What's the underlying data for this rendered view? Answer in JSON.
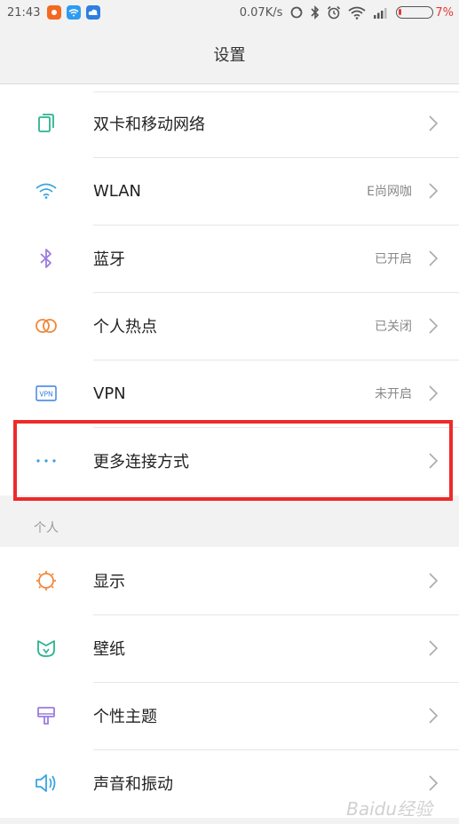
{
  "status_bar": {
    "time": "21:43",
    "speed": "0.07K/s",
    "battery": "7%",
    "battery_level": 0.07,
    "colors": {
      "app1": "#f26a21",
      "app2": "#2e9bf0",
      "app3": "#2e7fe0",
      "battery": "#e53935"
    }
  },
  "header": {
    "title": "设置"
  },
  "network_section": {
    "items": [
      {
        "label": "双卡和移动网络",
        "value": "",
        "icon": "sim-card-icon",
        "color": "#2bb38f"
      },
      {
        "label": "WLAN",
        "value": "E尚网咖",
        "icon": "wifi-icon",
        "color": "#3aa6e0"
      },
      {
        "label": "蓝牙",
        "value": "已开启",
        "icon": "bluetooth-icon",
        "color": "#9b7be0"
      },
      {
        "label": "个人热点",
        "value": "已关闭",
        "icon": "hotspot-icon",
        "color": "#f0873a"
      },
      {
        "label": "VPN",
        "value": "未开启",
        "icon": "vpn-icon",
        "color": "#3a7ee0"
      },
      {
        "label": "更多连接方式",
        "value": "",
        "icon": "more-icon",
        "color": "#3a9be0"
      }
    ]
  },
  "personal_section": {
    "label": "个人",
    "items": [
      {
        "label": "显示",
        "icon": "sun-icon",
        "color": "#f0873a"
      },
      {
        "label": "壁纸",
        "icon": "wallpaper-icon",
        "color": "#2bb38f"
      },
      {
        "label": "个性主题",
        "icon": "theme-brush-icon",
        "color": "#9b7be0"
      },
      {
        "label": "声音和振动",
        "icon": "speaker-icon",
        "color": "#3aa6e0"
      }
    ]
  },
  "watermark": "Baidu经验"
}
